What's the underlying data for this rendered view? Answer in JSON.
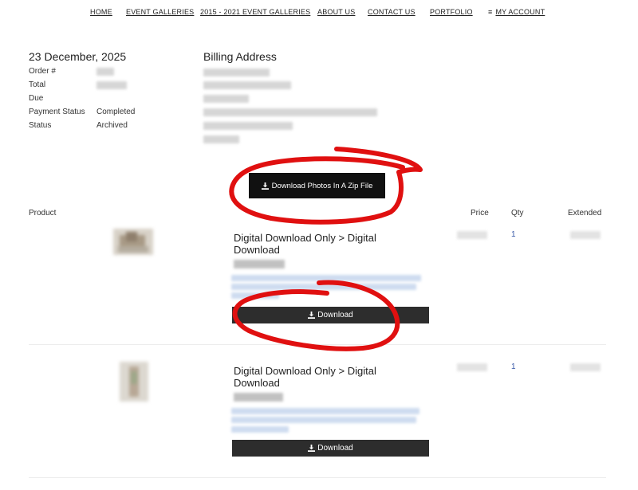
{
  "nav": {
    "items": [
      {
        "label": "HOME"
      },
      {
        "label": "EVENT GALLERIES"
      },
      {
        "label": "2015 - 2021 EVENT GALLERIES"
      },
      {
        "label": "ABOUT US"
      },
      {
        "label": "CONTACT US"
      },
      {
        "label": "PORTFOLIO"
      },
      {
        "label": "MY ACCOUNT",
        "icon": "menu-icon"
      }
    ]
  },
  "order": {
    "date": "23 December, 2025",
    "fields": [
      {
        "label": "Order #",
        "value": ""
      },
      {
        "label": "Total",
        "value": ""
      },
      {
        "label": "Due",
        "value": ""
      },
      {
        "label": "Payment Status",
        "value": "Completed"
      },
      {
        "label": "Status",
        "value": "Archived"
      }
    ]
  },
  "billing": {
    "title": "Billing Address"
  },
  "zip_button": {
    "label": "Download Photos In A Zip File",
    "icon": "download-icon"
  },
  "table": {
    "headers": {
      "product": "Product",
      "price": "Price",
      "qty": "Qty",
      "extended": "Extended"
    },
    "rows": [
      {
        "title": "Digital Download Only > Digital Download",
        "qty": "1",
        "download_label": "Download",
        "icon": "download-icon"
      },
      {
        "title": "Digital Download Only > Digital Download",
        "qty": "1",
        "download_label": "Download",
        "icon": "download-icon"
      }
    ]
  },
  "colors": {
    "button_dark": "#111111",
    "download_button": "#2d2d2d",
    "annotation_red": "#e01010",
    "link_blue": "#3a5aa8"
  }
}
